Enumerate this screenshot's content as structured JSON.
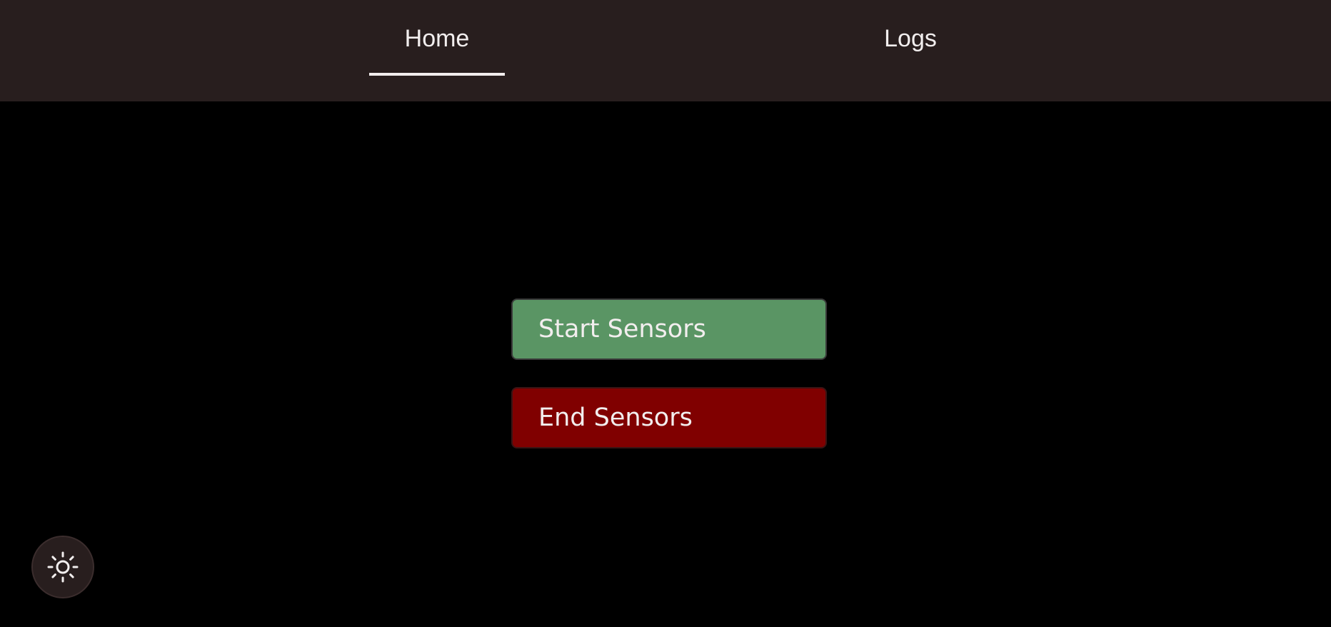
{
  "nav": {
    "tabs": [
      {
        "label": "Home",
        "active": true
      },
      {
        "label": "Logs",
        "active": false
      }
    ]
  },
  "main": {
    "start_label": "Start Sensors",
    "end_label": "End Sensors"
  },
  "theme_toggle": {
    "icon": "sun-icon"
  },
  "colors": {
    "topbar": "#281e1e",
    "background": "#000000",
    "start_button": "#5a9564",
    "end_button": "#800000",
    "text": "#f2eeee"
  }
}
